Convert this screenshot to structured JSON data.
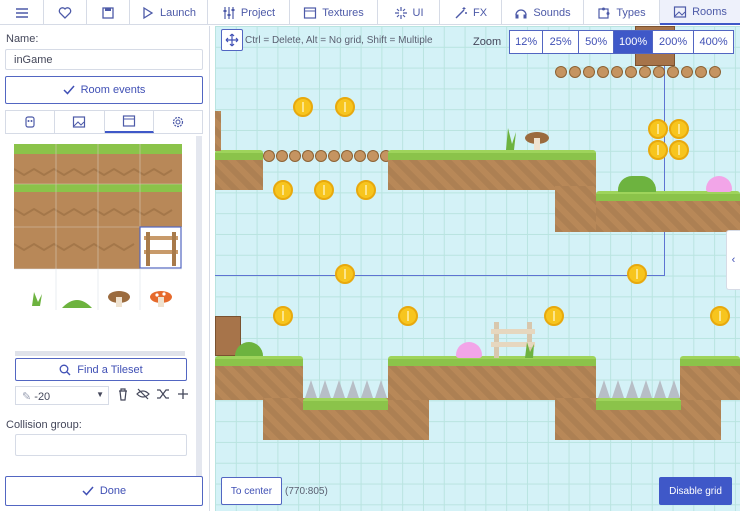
{
  "toolbar": {
    "items": [
      {
        "label": "",
        "icon": "menu-icon"
      },
      {
        "label": "",
        "icon": "heart-icon"
      },
      {
        "label": "",
        "icon": "save-icon"
      },
      {
        "label": "Launch",
        "icon": "play-icon"
      },
      {
        "label": "Project",
        "icon": "sliders-icon"
      },
      {
        "label": "Textures",
        "icon": "image-frame-icon"
      },
      {
        "label": "UI",
        "icon": "sparkle-icon"
      },
      {
        "label": "FX",
        "icon": "magic-icon"
      },
      {
        "label": "Sounds",
        "icon": "headphones-icon"
      },
      {
        "label": "Types",
        "icon": "puzzle-icon"
      },
      {
        "label": "Rooms",
        "icon": "landscape-icon"
      }
    ],
    "active": "Rooms"
  },
  "left": {
    "name_label": "Name:",
    "name_value": "inGame",
    "room_events_label": "Room events",
    "tabs": [
      "copy-icon",
      "image-icon",
      "layout-icon",
      "gear-icon"
    ],
    "find_tileset_label": "Find a Tileset",
    "depth_value": "-20",
    "collision_label": "Collision group:",
    "collision_value": "",
    "done_label": "Done"
  },
  "stage": {
    "hint": "Ctrl = Delete, Alt = No grid, Shift = Multiple",
    "zoom_label": "Zoom",
    "zoom_options": [
      "12%",
      "25%",
      "50%",
      "100%",
      "200%",
      "400%"
    ],
    "zoom_active": "100%",
    "to_center_label": "To center",
    "coords": "(770:805)",
    "disable_grid_label": "Disable grid"
  },
  "colors": {
    "accent": "#3f58c8",
    "grass": "#8bc34a",
    "dirt": "#b88858",
    "coin": "#f7c51e",
    "sky": "#d4f2f7"
  }
}
